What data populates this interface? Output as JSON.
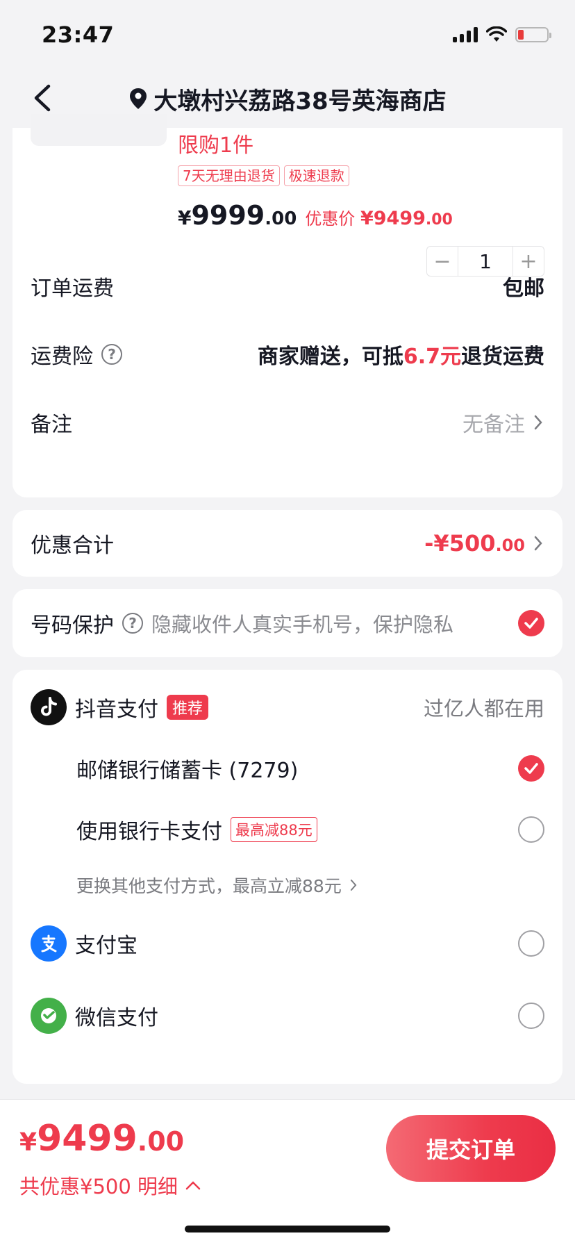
{
  "status_bar": {
    "time": "23:47"
  },
  "header": {
    "address": "大墩村兴荔路38号英海商店"
  },
  "product": {
    "limit": "限购1件",
    "tags": [
      "7天无理由退货",
      "极速退款"
    ],
    "price_symbol": "¥",
    "price_int": "9999",
    "price_dec": ".00",
    "sale_label": "优惠价",
    "sale_int": "¥9499",
    "sale_dec": ".00",
    "quantity": "1",
    "minus": "−",
    "plus": "+"
  },
  "order": {
    "shipping_label": "订单运费",
    "shipping_value": "包邮",
    "insurance_label": "运费险",
    "insurance_prefix": "商家赠送，可抵",
    "insurance_amount": "6.7元",
    "insurance_suffix": "退货运费",
    "note_label": "备注",
    "note_value": "无备注"
  },
  "discount": {
    "label": "优惠合计",
    "amount_int": "-¥500",
    "amount_dec": ".00"
  },
  "protect": {
    "label": "号码保护",
    "desc": "隐藏收件人真实手机号，保护隐私"
  },
  "payment": {
    "douyin_label": "抖音支付",
    "douyin_badge": "推荐",
    "douyin_slogan": "过亿人都在用",
    "card_saved": "邮储银行储蓄卡 (7279)",
    "card_new": "使用银行卡支付",
    "card_new_badge": "最高减88元",
    "more_link": "更换其他支付方式，最高立减88元",
    "alipay": "支付宝",
    "wechat": "微信支付"
  },
  "bottom": {
    "yen": "¥",
    "total_int": "9499",
    "total_dec": ".00",
    "detail": "共优惠¥500 明细",
    "submit": "提交订单"
  },
  "colors": {
    "accent": "#ee3b4d",
    "text": "#161823",
    "muted": "#a7a8ad"
  }
}
